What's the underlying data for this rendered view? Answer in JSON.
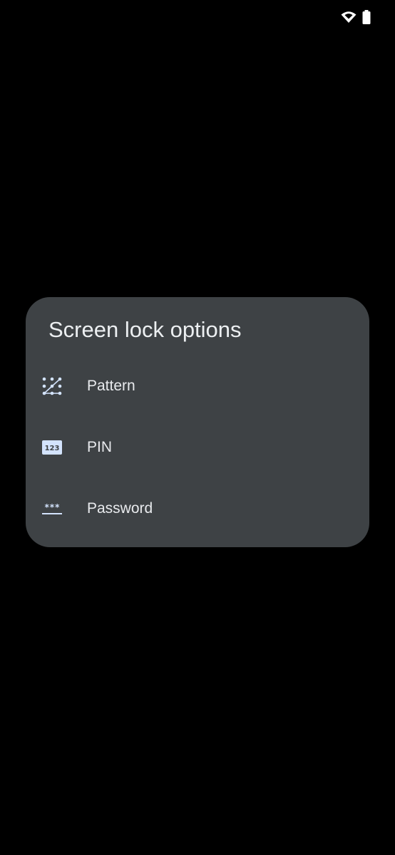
{
  "status_bar": {
    "icons": [
      "wifi-icon",
      "battery-icon"
    ]
  },
  "dialog": {
    "title": "Screen lock options",
    "options": [
      {
        "label": "Pattern",
        "icon": "pattern-icon"
      },
      {
        "label": "PIN",
        "icon": "pin-icon",
        "icon_text": "123"
      },
      {
        "label": "Password",
        "icon": "password-icon",
        "icon_text": "***"
      }
    ]
  },
  "colors": {
    "background": "#000000",
    "dialog_surface": "#3e4245",
    "icon_accent": "#d3e3fd",
    "text_primary": "#e8eaed"
  }
}
